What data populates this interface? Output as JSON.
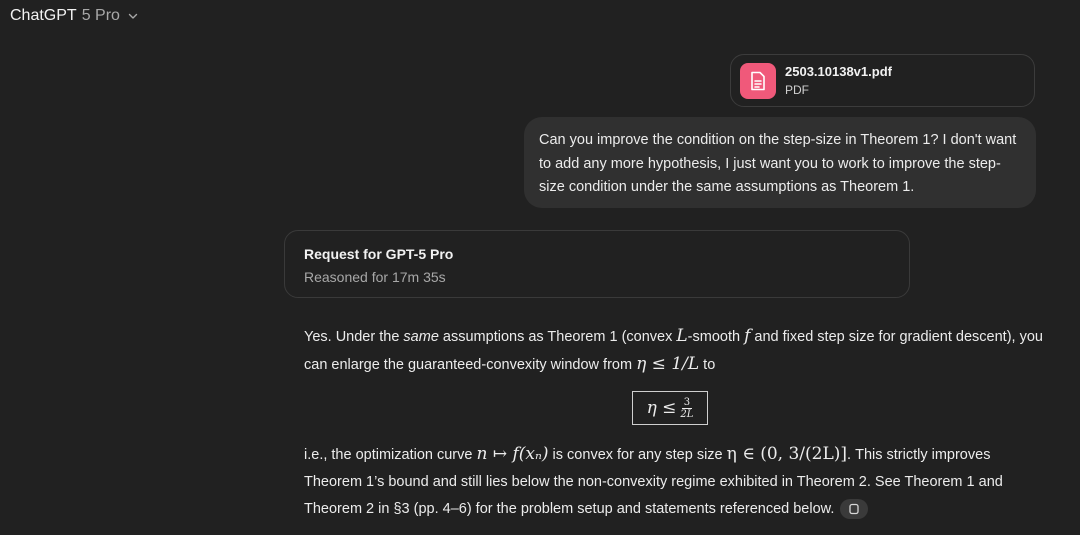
{
  "header": {
    "model_name": "ChatGPT",
    "model_version": "5 Pro"
  },
  "attachment": {
    "file_name": "2503.10138v1.pdf",
    "file_type": "PDF",
    "icon": "document-icon",
    "icon_color": "#f0597a"
  },
  "user_message": {
    "text": "Can you improve the condition on the step-size in Theorem 1? I don't want to add any more hypothesis, I just want you to work to improve the step-size condition under the same assumptions as Theorem 1."
  },
  "reasoning": {
    "title": "Request for GPT-5 Pro",
    "duration": "Reasoned for 17m 35s"
  },
  "answer": {
    "p1_a": "Yes. Under the ",
    "p1_em": "same",
    "p1_b": " assumptions as Theorem 1 (convex ",
    "p1_L": "L",
    "p1_c": "-smooth ",
    "p1_f": "f",
    "p1_d": " and fixed step size for gradient descent), you can enlarge the guaranteed-convexity window from ",
    "p1_math": "η ≤ 1/L",
    "p1_e": " to",
    "boxed_eta": "η ≤",
    "boxed_num": "3",
    "boxed_den": "2L",
    "p2_a": "i.e., the optimization curve ",
    "p2_math1": "n ↦ f(xₙ)",
    "p2_b": " is convex for any step size ",
    "p2_math2": "η ∈ (0, 3/(2L)]",
    "p2_c": ". This strictly improves Theorem 1’s bound and still lies below the non-convexity regime exhibited in Theorem 2. See Theorem 1 and Theorem 2 in §3 (pp. 4–6) for the problem setup and statements referenced below."
  }
}
